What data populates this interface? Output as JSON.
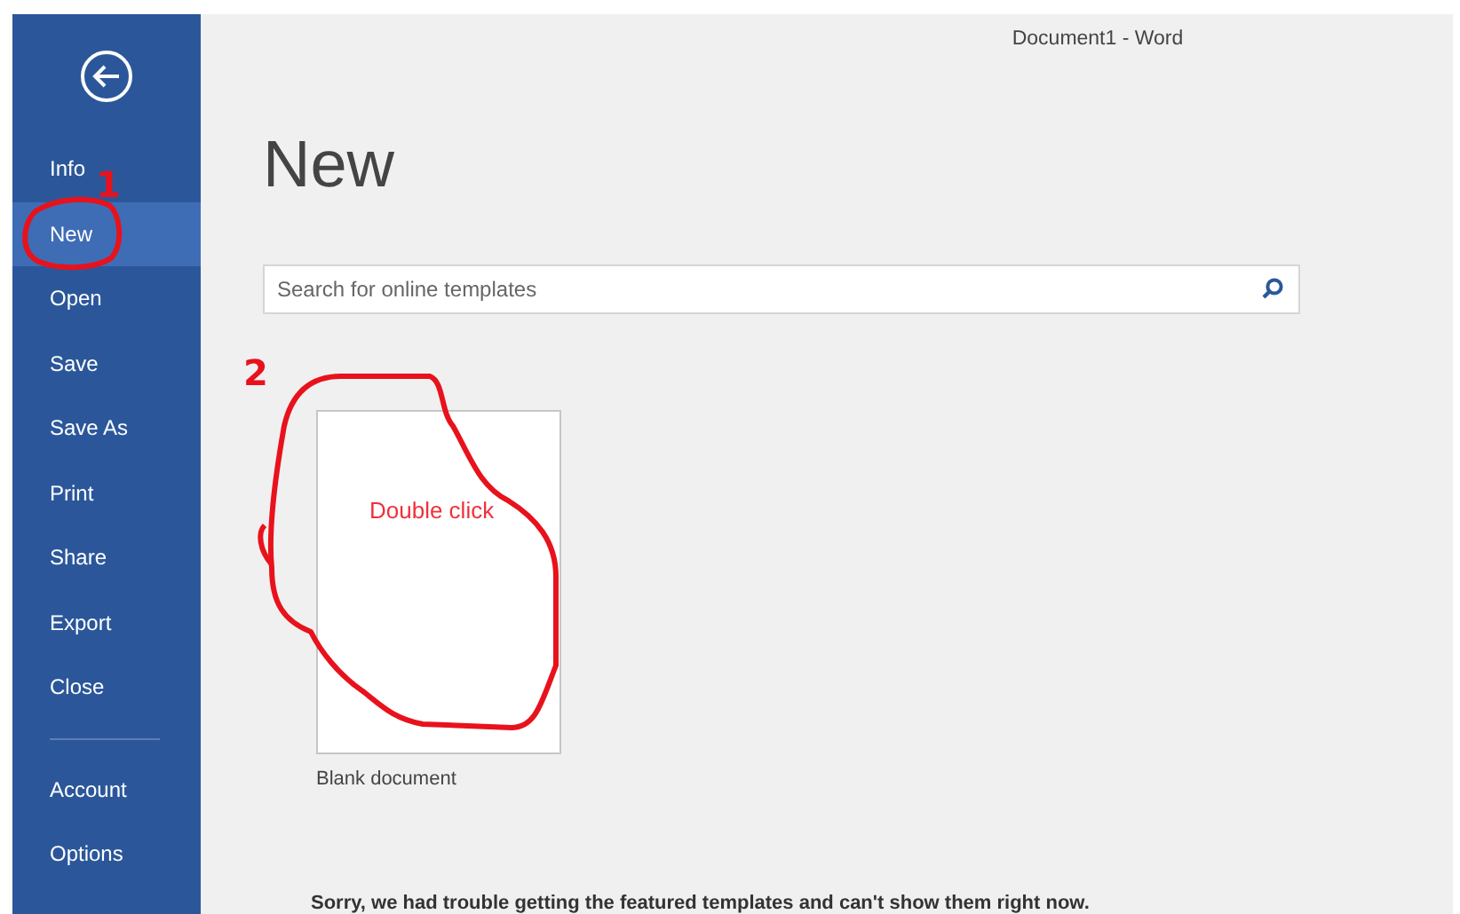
{
  "window": {
    "title": "Document1 - Word"
  },
  "sidebar": {
    "items": [
      {
        "label": "Info",
        "selected": false
      },
      {
        "label": "New",
        "selected": true
      },
      {
        "label": "Open",
        "selected": false
      },
      {
        "label": "Save",
        "selected": false
      },
      {
        "label": "Save As",
        "selected": false
      },
      {
        "label": "Print",
        "selected": false
      },
      {
        "label": "Share",
        "selected": false
      },
      {
        "label": "Export",
        "selected": false
      },
      {
        "label": "Close",
        "selected": false
      }
    ],
    "footer_items": [
      {
        "label": "Account",
        "selected": false
      },
      {
        "label": "Options",
        "selected": false
      }
    ]
  },
  "page": {
    "heading": "New",
    "search": {
      "placeholder": "Search for online templates"
    },
    "templates": [
      {
        "label": "Blank document"
      }
    ],
    "message": "Sorry, we had trouble getting the featured templates and can't show them right now."
  },
  "annotations": [
    {
      "kind": "number",
      "text": "1"
    },
    {
      "kind": "number",
      "text": "2"
    },
    {
      "kind": "note",
      "text": "Double click"
    }
  ]
}
